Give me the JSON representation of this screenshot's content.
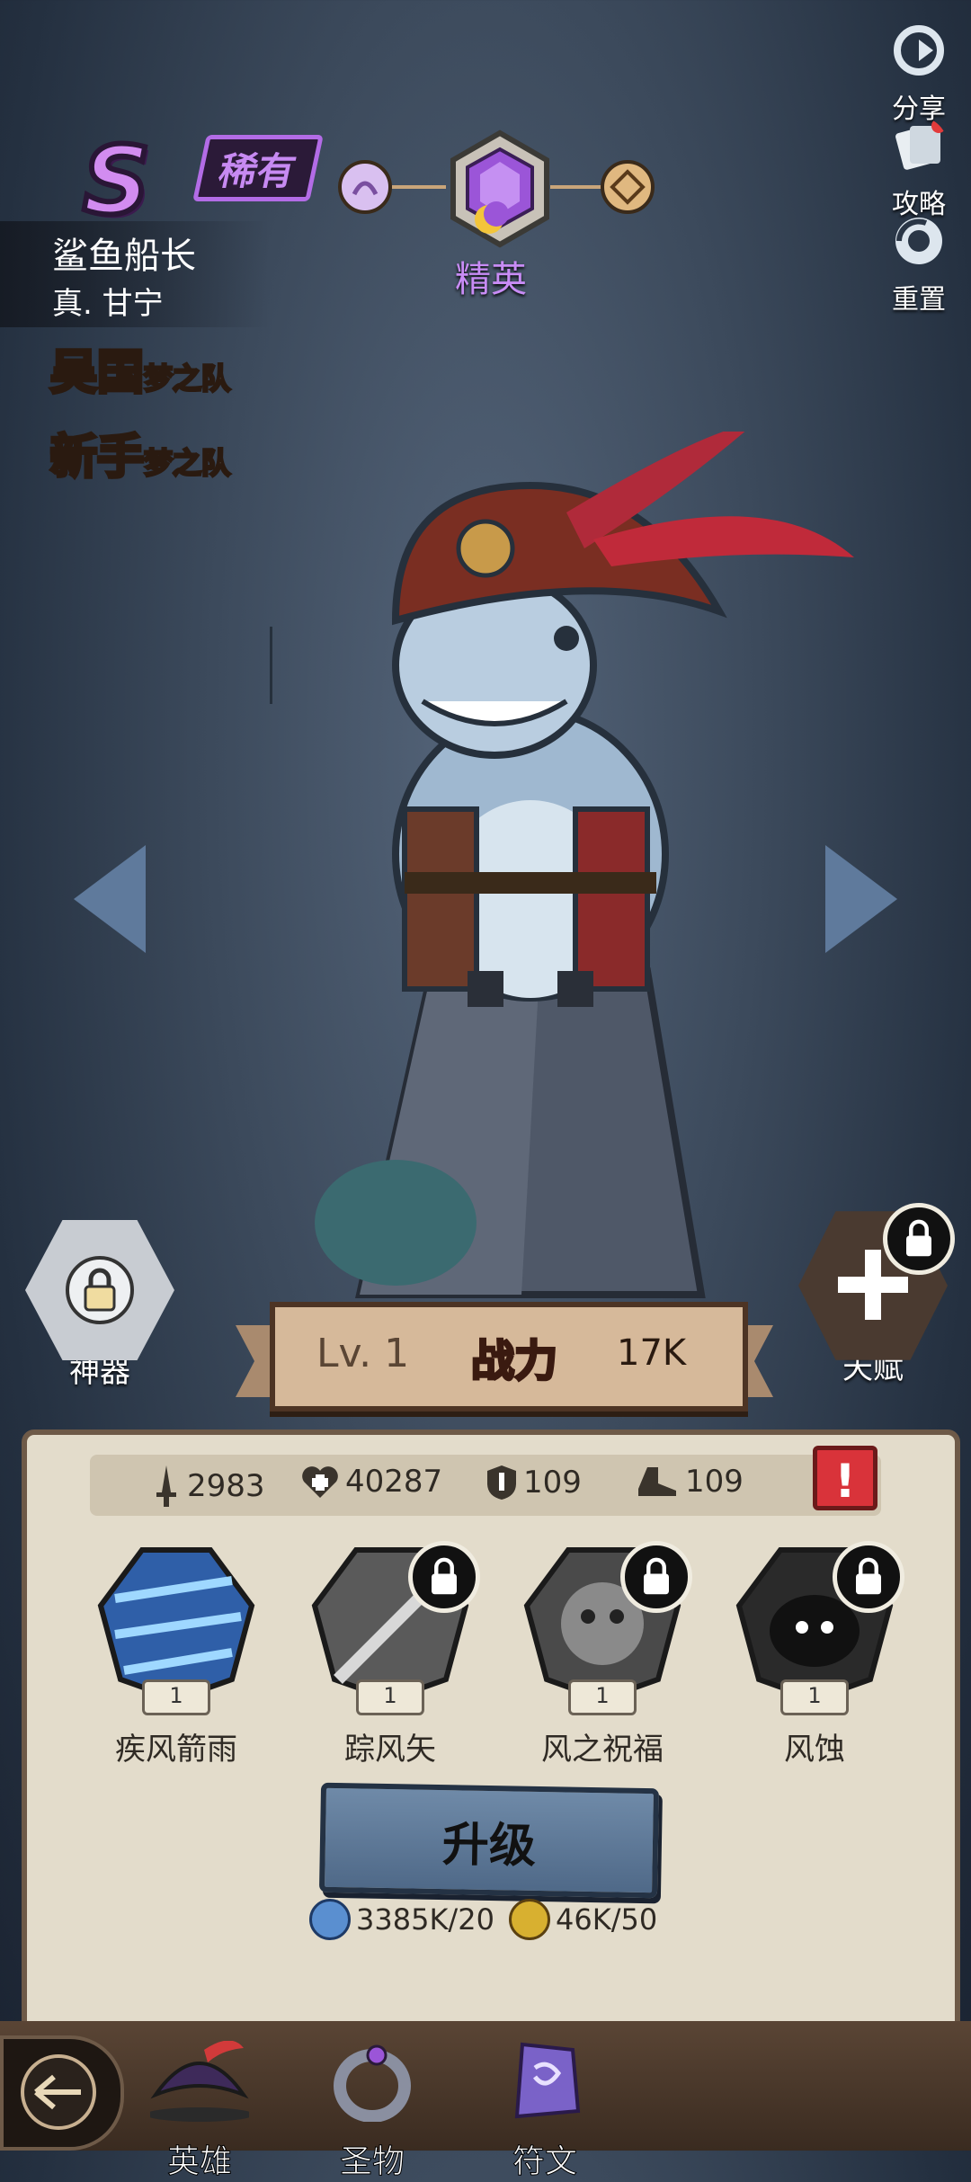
{
  "side_buttons": [
    {
      "label": "分享",
      "icon": "share-icon"
    },
    {
      "label": "攻略",
      "icon": "guide-cards-icon"
    },
    {
      "label": "重置",
      "icon": "reset-icon"
    }
  ],
  "hero": {
    "rank": "S",
    "rarity": "稀有",
    "grade": "精英",
    "name": "鲨鱼船长",
    "subtitle": "真. 甘宁",
    "teams": [
      {
        "name": "吴国",
        "suffix": "梦之队",
        "color": "#f08a3a"
      },
      {
        "name": "新手",
        "suffix": "梦之队",
        "color": "#5ec8f0"
      }
    ]
  },
  "artifact_label": "神器",
  "talent_label": "天赋",
  "level": {
    "label": "Lv. 1",
    "power_label": "战力",
    "power_value": "17K"
  },
  "stats": [
    {
      "icon": "sword-icon",
      "value": "2983"
    },
    {
      "icon": "health-cross-icon",
      "value": "40287"
    },
    {
      "icon": "shield-icon",
      "value": "109"
    },
    {
      "icon": "boot-icon",
      "value": "109"
    }
  ],
  "skills": [
    {
      "name": "疾风箭雨",
      "level": "1",
      "locked": false
    },
    {
      "name": "踪风矢",
      "level": "1",
      "locked": true
    },
    {
      "name": "风之祝福",
      "level": "1",
      "locked": true
    },
    {
      "name": "风蚀",
      "level": "1",
      "locked": true
    }
  ],
  "upgrade_label": "升级",
  "costs": [
    {
      "icon": "exp-orb-icon",
      "value": "3385K/20",
      "color": "#5a8fd0"
    },
    {
      "icon": "gold-coin-icon",
      "value": "46K/50",
      "color": "#d8b030"
    }
  ],
  "nav": [
    {
      "label": "英雄",
      "icon": "pirate-hat-icon"
    },
    {
      "label": "圣物",
      "icon": "ring-icon"
    },
    {
      "label": "符文",
      "icon": "rune-stone-icon"
    }
  ],
  "colors": {
    "accent": "#b36ce6",
    "panel": "#e3dccb",
    "warning": "#d9333a"
  }
}
